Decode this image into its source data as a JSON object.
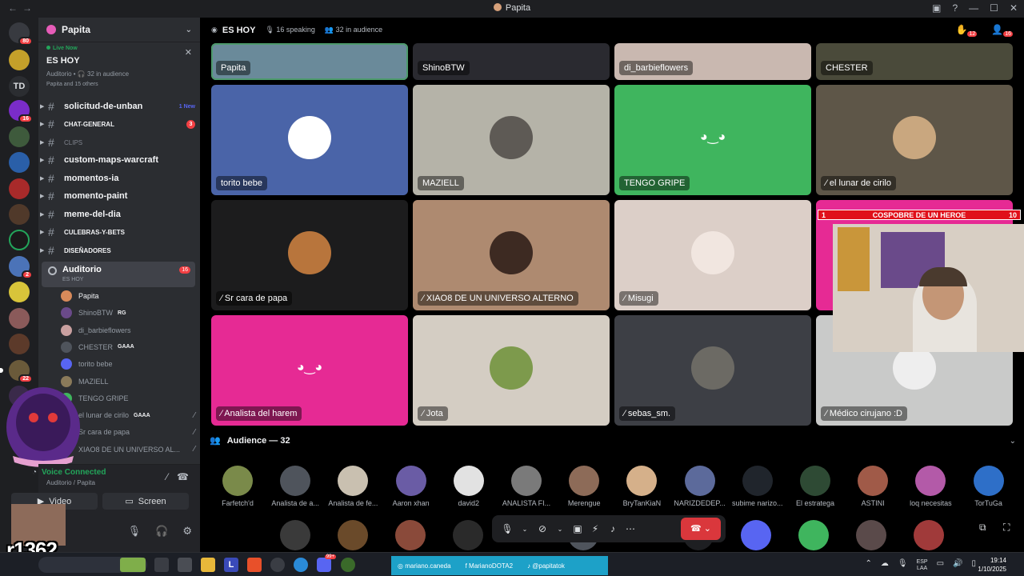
{
  "window": {
    "title": "Papita"
  },
  "server": {
    "name": "Papita"
  },
  "live_card": {
    "status": "Live Now",
    "title": "ES HOY",
    "subtitle": "Auditorio • 🎧 32 in audience",
    "people": "Papita and 15 others"
  },
  "guild_badges": {
    "home": "80",
    "g5": "16",
    "g11": "2",
    "g17": "22"
  },
  "guild_td": "TD",
  "channels": [
    {
      "name": "solicitud-de-unban",
      "meta": "1 New"
    },
    {
      "name": "CHAT-GENERAL",
      "meta": "3"
    },
    {
      "name": "CLIPS",
      "meta": ""
    },
    {
      "name": "custom-maps-warcraft",
      "meta": ""
    },
    {
      "name": "momentos-ia",
      "meta": ""
    },
    {
      "name": "momento-paint",
      "meta": ""
    },
    {
      "name": "meme-del-dia",
      "meta": ""
    },
    {
      "name": "CULEBRAS-Y-BETS",
      "meta": ""
    },
    {
      "name": "DISEÑADORES",
      "meta": ""
    }
  ],
  "voice_channel": {
    "name": "Auditorio",
    "sub": "ES HOY",
    "count": "16"
  },
  "voice_users": [
    {
      "name": "Papita",
      "tag": ""
    },
    {
      "name": "ShinoBTW",
      "tag": "RG"
    },
    {
      "name": "di_barbieflowers",
      "tag": ""
    },
    {
      "name": "CHESTER",
      "tag": "GAAA"
    },
    {
      "name": "torito bebe",
      "tag": ""
    },
    {
      "name": "MAZIELL",
      "tag": ""
    },
    {
      "name": "TENGO GRIPE",
      "tag": ""
    },
    {
      "name": "el lunar de cirilo",
      "tag": "GAAA"
    },
    {
      "name": "Sr cara de papa",
      "tag": ""
    },
    {
      "name": "XIAO8 DE UN UNIVERSO AL...",
      "tag": ""
    }
  ],
  "voice_connected": {
    "status": "Voice Connected",
    "location": "Auditorio / Papita",
    "video_label": "Video",
    "screen_label": "Screen"
  },
  "watermark": "r1362",
  "stage": {
    "name": "ES HOY",
    "speaking": "16 speaking",
    "audience": "32 in audience",
    "hdr_badge1": "12",
    "hdr_badge2": "16"
  },
  "tiles_top": [
    "Papita",
    "ShinoBTW",
    "di_barbieflowers",
    "CHESTER"
  ],
  "tiles": [
    {
      "name": "torito bebe",
      "color": "#4a64a8",
      "pic": "#ffffff"
    },
    {
      "name": "MAZIELL",
      "color": "#b5b3a8",
      "pic": "#5e5a55"
    },
    {
      "name": "TENGO GRIPE",
      "color": "#3fb55e",
      "pic": "discord"
    },
    {
      "name": "el lunar de cirilo",
      "color": "#5e5648",
      "pic": "#c9a77f"
    },
    {
      "name": "Sr cara de papa",
      "color": "#1c1c1d",
      "pic": "#b8753c"
    },
    {
      "name": "XIAO8 DE UN UNIVERSO ALTERNO",
      "color": "#ae8a70",
      "pic": "#3d2a22"
    },
    {
      "name": "Misugi",
      "color": "#dccfc8",
      "pic": "#f1e6e0"
    },
    {
      "name": "",
      "color": "#e62a94",
      "pic": ""
    },
    {
      "name": "Analista del harem",
      "color": "#e62a94",
      "pic": "discord"
    },
    {
      "name": "Jota",
      "color": "#d4cdc3",
      "pic": "#7d9a4c"
    },
    {
      "name": "sebas_sm.",
      "color": "#3d3f45",
      "pic": "#6c6a64"
    },
    {
      "name": "Médico cirujano :D",
      "color": "#c9cac9",
      "pic": "#eeeeee"
    }
  ],
  "overlay": {
    "left": "1",
    "title": "COSPOBRE DE UN HEROE",
    "right": "10"
  },
  "audience": {
    "label": "Audience — 32"
  },
  "audience_members": [
    {
      "name": "Farfetch'd",
      "color": "#7a8a4a"
    },
    {
      "name": "Analista de a...",
      "color": "#4f545c"
    },
    {
      "name": "Analista de fe...",
      "color": "#c9c0b0"
    },
    {
      "name": "Aaron xhan",
      "color": "#6a5ca5"
    },
    {
      "name": "david2",
      "color": "#e2e2e2"
    },
    {
      "name": "ANALISTA FI...",
      "color": "#7a7a7a"
    },
    {
      "name": "Merengue",
      "color": "#8d6b58"
    },
    {
      "name": "BryTanKiaN",
      "color": "#d5b08a"
    },
    {
      "name": "NARIZDEDEP...",
      "color": "#5c6a9b"
    },
    {
      "name": "subime narizo...",
      "color": "#20252c"
    },
    {
      "name": "El estratega",
      "color": "#2e4a34"
    },
    {
      "name": "ASTINI",
      "color": "#a05a48"
    },
    {
      "name": "loq necesitas",
      "color": "#b35aa8"
    },
    {
      "name": "TorTuGa",
      "color": "#2e6fc8"
    }
  ],
  "taskbar": {
    "social1": "mariano.caneda",
    "social2": "MarianoDOTA2",
    "social3": "@papitatok",
    "lang1": "ESP",
    "lang2": "LAA",
    "time": "19:14",
    "date": "1/10/2025",
    "discord_badge": "99+",
    "app_l": "L"
  }
}
